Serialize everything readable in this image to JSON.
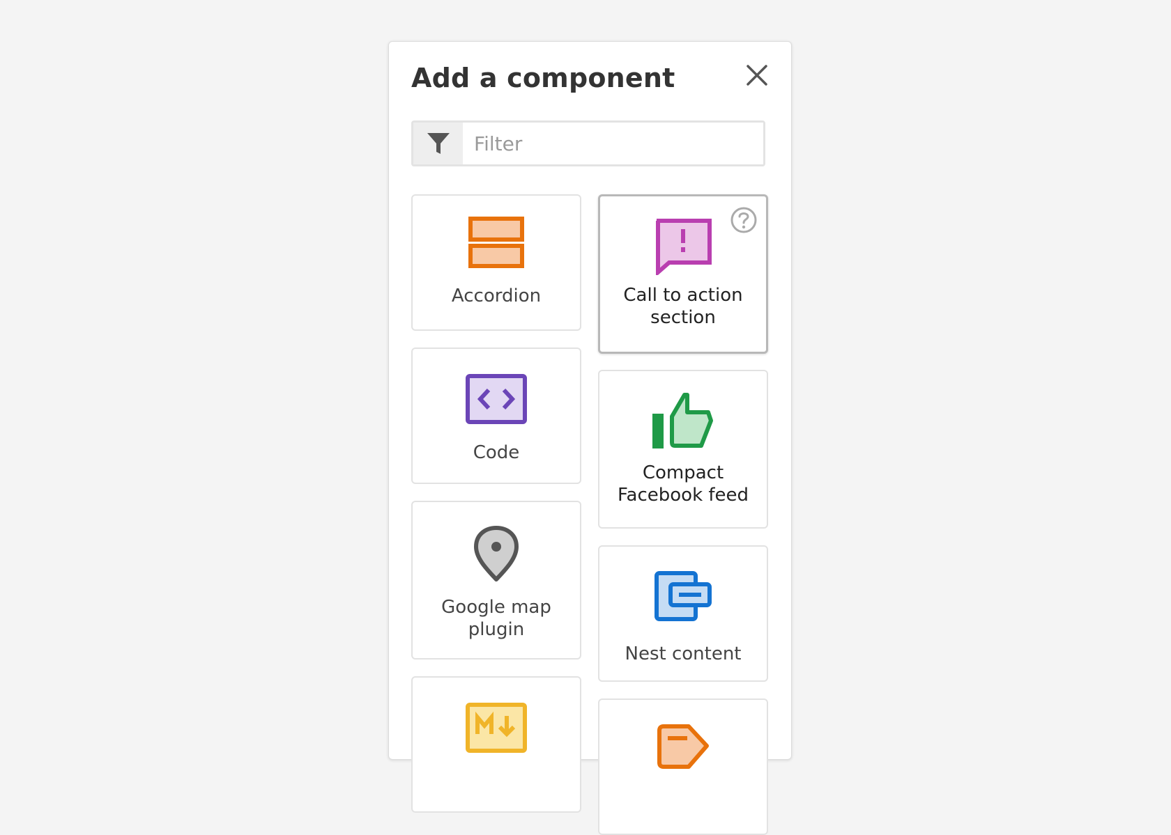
{
  "dialog": {
    "title": "Add a component",
    "close_icon": "close-icon",
    "filter": {
      "placeholder": "Filter",
      "value": "",
      "icon": "filter-icon"
    }
  },
  "components": [
    {
      "label": "Accordion",
      "icon": "accordion-icon",
      "color": "#e8720c"
    },
    {
      "label": "Call to action section",
      "icon": "call-to-action-icon",
      "color": "#b93fb0",
      "active": true,
      "help_icon": "help-icon"
    },
    {
      "label": "Code",
      "icon": "code-icon",
      "color": "#6b45b7"
    },
    {
      "label": "Compact Facebook feed",
      "icon": "thumbs-up-icon",
      "color": "#1f9a47"
    },
    {
      "label": "Google map plugin",
      "icon": "map-pin-icon",
      "color": "#555555"
    },
    {
      "label": "Nest content",
      "icon": "nest-content-icon",
      "color": "#1473d2"
    },
    {
      "label": "",
      "icon": "markdown-icon",
      "color": "#f0b429"
    },
    {
      "label": "",
      "icon": "tag-icon",
      "color": "#e8720c"
    }
  ]
}
